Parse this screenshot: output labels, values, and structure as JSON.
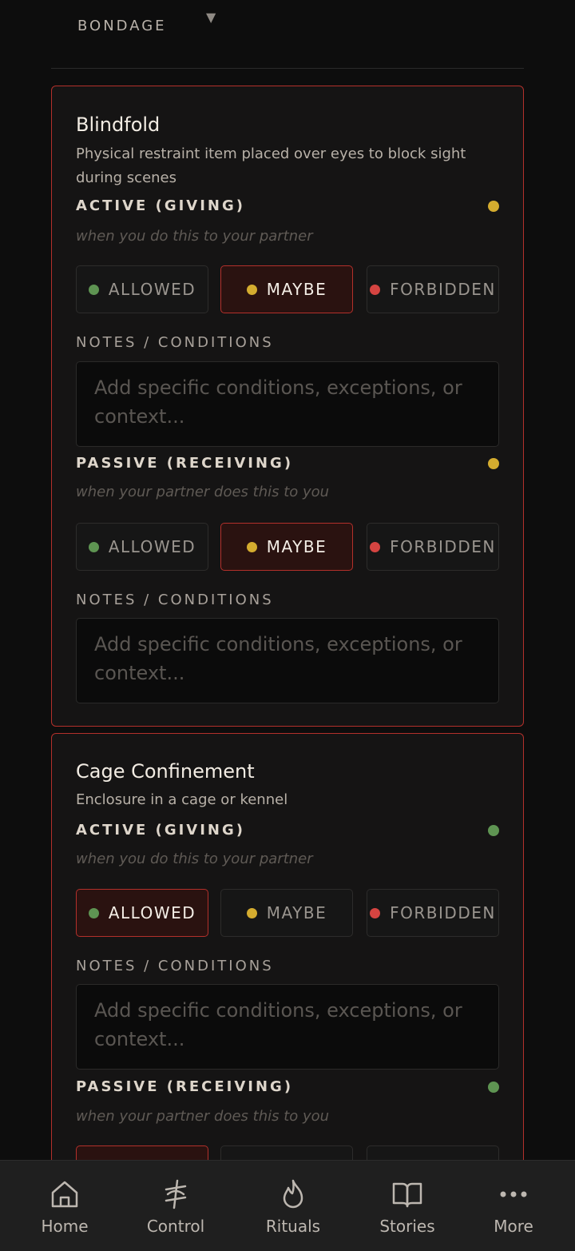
{
  "section": {
    "title": "BONDAGE",
    "caret": "▼"
  },
  "options_labels": {
    "allowed": "ALLOWED",
    "maybe": "MAYBE",
    "forbidden": "FORBIDDEN"
  },
  "colors": {
    "accent": "#b3302b",
    "allowed": "#5e9452",
    "maybe": "#d4ac2f",
    "forbidden": "#d54441"
  },
  "items": [
    {
      "title": "Blindfold",
      "description": "Physical restraint item placed over eyes to block sight during scenes",
      "active": {
        "label": "ACTIVE (GIVING)",
        "subtitle": "when you do this to your partner",
        "selected": "maybe",
        "notes_label": "NOTES / CONDITIONS",
        "notes_placeholder": "Add specific conditions, exceptions, or context..."
      },
      "passive": {
        "label": "PASSIVE (RECEIVING)",
        "subtitle": "when your partner does this to you",
        "selected": "maybe",
        "notes_label": "NOTES / CONDITIONS",
        "notes_placeholder": "Add specific conditions, exceptions, or context..."
      }
    },
    {
      "title": "Cage Confinement",
      "description": "Enclosure in a cage or kennel",
      "active": {
        "label": "ACTIVE (GIVING)",
        "subtitle": "when you do this to your partner",
        "selected": "allowed",
        "notes_label": "NOTES / CONDITIONS",
        "notes_placeholder": "Add specific conditions, exceptions, or context..."
      },
      "passive": {
        "label": "PASSIVE (RECEIVING)",
        "subtitle": "when your partner does this to you",
        "selected": "allowed"
      }
    }
  ],
  "nav": [
    {
      "label": "Home",
      "icon": "home-icon"
    },
    {
      "label": "Control",
      "icon": "control-icon"
    },
    {
      "label": "Rituals",
      "icon": "flame-icon"
    },
    {
      "label": "Stories",
      "icon": "book-icon"
    },
    {
      "label": "More",
      "icon": "more-icon"
    }
  ]
}
